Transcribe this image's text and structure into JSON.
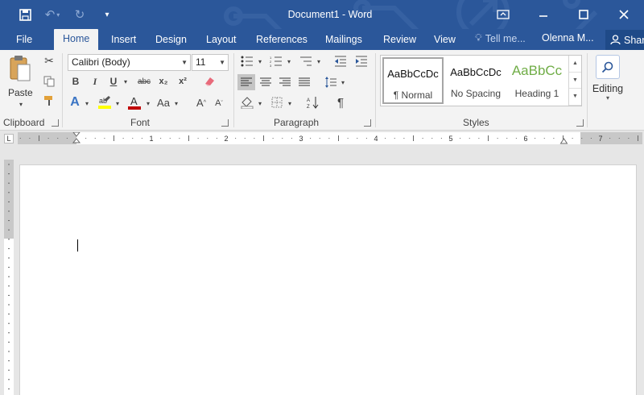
{
  "window": {
    "title": "Document1 - Word",
    "accent_color": "#2b579a",
    "quick_access": [
      "save-icon",
      "undo-icon",
      "redo-icon",
      "customize-qat-icon"
    ],
    "controls": [
      "ribbon-display-options-icon",
      "minimize-icon",
      "maximize-icon",
      "close-icon"
    ]
  },
  "tabs": {
    "items": [
      "File",
      "Home",
      "Insert",
      "Design",
      "Layout",
      "References",
      "Mailings",
      "Review",
      "View"
    ],
    "active": "Home",
    "tell_me": "Tell me...",
    "user": "Olenna M...",
    "share": "Shar"
  },
  "ribbon": {
    "clipboard": {
      "label": "Clipboard",
      "paste": "Paste"
    },
    "font": {
      "label": "Font",
      "family": "Calibri (Body)",
      "size": "11",
      "bold": "B",
      "italic": "I",
      "underline": "U",
      "strike": "abc",
      "subscript": "x₂",
      "superscript": "x²",
      "grow": "A",
      "shrink": "A",
      "change_case": "Aa",
      "font_color": "#c00000",
      "highlight_color": "#ffff00"
    },
    "paragraph": {
      "label": "Paragraph"
    },
    "styles": {
      "label": "Styles",
      "items": [
        {
          "preview": "AaBbCcDc",
          "name": "¶ Normal"
        },
        {
          "preview": "AaBbCcDc",
          "name": "No Spacing"
        },
        {
          "preview": "AaBbCc",
          "name": "Heading 1",
          "color": "#70ad47"
        }
      ]
    },
    "editing": {
      "label": "Editing"
    }
  },
  "ruler": {
    "tab_selector": "L",
    "numbers": [
      "1",
      "2",
      "3",
      "4",
      "5",
      "6",
      "7"
    ]
  }
}
